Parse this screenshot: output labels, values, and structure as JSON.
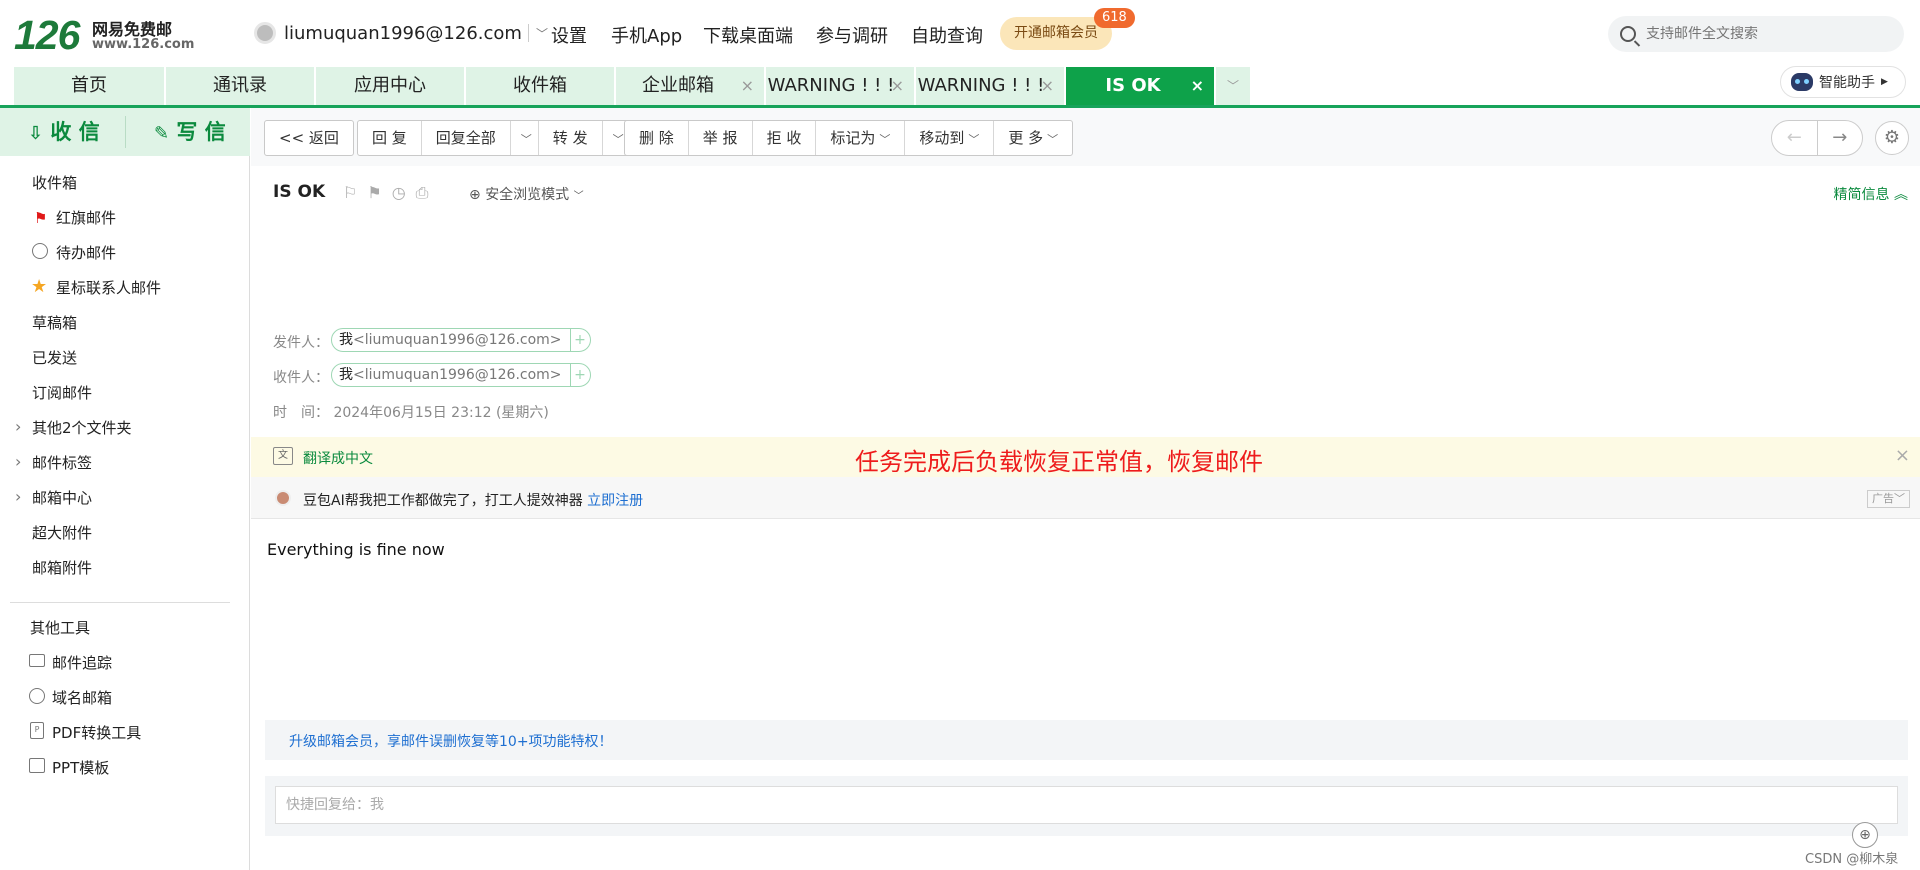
{
  "logo": {
    "number": "126",
    "title": "网易免费邮",
    "domain": "www.126.com"
  },
  "account": {
    "email": "liumuquan1996@126.com"
  },
  "top_nav": [
    "设置",
    "手机App",
    "下载桌面端",
    "参与调研",
    "自助查询"
  ],
  "vip": {
    "label": "开通邮箱会员",
    "badge": "618"
  },
  "search": {
    "placeholder": "支持邮件全文搜索"
  },
  "tabs": [
    {
      "label": "首页"
    },
    {
      "label": "通讯录"
    },
    {
      "label": "应用中心"
    },
    {
      "label": "收件箱"
    },
    {
      "label": "企业邮箱",
      "close": "×"
    },
    {
      "label": "WARNING ! ! !",
      "close": "×"
    },
    {
      "label": "WARNING ! ! !",
      "close": "×"
    },
    {
      "label": "IS OK",
      "close": "×",
      "active": true
    }
  ],
  "assistant": {
    "label": "智能助手"
  },
  "sidebar": {
    "receive": "收 信",
    "write": "写 信",
    "folders": [
      {
        "label": "收件箱"
      },
      {
        "label": "红旗邮件",
        "icon": "red-flag-icon"
      },
      {
        "label": "待办邮件",
        "icon": "clock-icon"
      },
      {
        "label": "星标联系人邮件",
        "icon": "star-icon"
      },
      {
        "label": "草稿箱"
      },
      {
        "label": "已发送"
      },
      {
        "label": "订阅邮件"
      },
      {
        "label": "其他2个文件夹",
        "expandable": true
      },
      {
        "label": "邮件标签",
        "expandable": true
      },
      {
        "label": "邮箱中心",
        "expandable": true
      },
      {
        "label": "超大附件"
      },
      {
        "label": "邮箱附件"
      }
    ],
    "tools_title": "其他工具",
    "tools": [
      {
        "label": "邮件追踪",
        "icon": "mail-track-icon"
      },
      {
        "label": "域名邮箱",
        "icon": "globe-icon"
      },
      {
        "label": "PDF转换工具",
        "icon": "pdf-icon"
      },
      {
        "label": "PPT模板",
        "icon": "ppt-icon"
      }
    ]
  },
  "toolbar": {
    "back": "<< 返回",
    "reply": "回 复",
    "reply_all": "回复全部",
    "forward": "转 发",
    "delete": "删 除",
    "report": "举 报",
    "reject": "拒 收",
    "mark_as": "标记为",
    "move_to": "移动到",
    "more": "更 多"
  },
  "mail": {
    "subject": "IS OK",
    "safe_mode": "安全浏览模式",
    "brief": "精简信息",
    "from_label": "发件人：",
    "to_label": "收件人：",
    "sender_name": "我",
    "sender_addr": "<liumuquan1996@126.com>",
    "recipient_name": "我",
    "recipient_addr": "<liumuquan1996@126.com>",
    "time_label": "时　间：",
    "time": "2024年06月15日 23:12 (星期六)",
    "body": "Everything is fine now"
  },
  "translate": {
    "label": "翻译成中文"
  },
  "annotation": "任务完成后负载恢复正常值，恢复邮件",
  "ad": {
    "text": "豆包AI帮我把工作都做完了，打工人提效神器",
    "link": "立即注册",
    "tag": "广告"
  },
  "upgrade": "升级邮箱会员，享邮件误删恢复等10+项功能特权！",
  "quick_reply": {
    "placeholder": "快捷回复给：我"
  },
  "watermark": "CSDN @柳木泉"
}
